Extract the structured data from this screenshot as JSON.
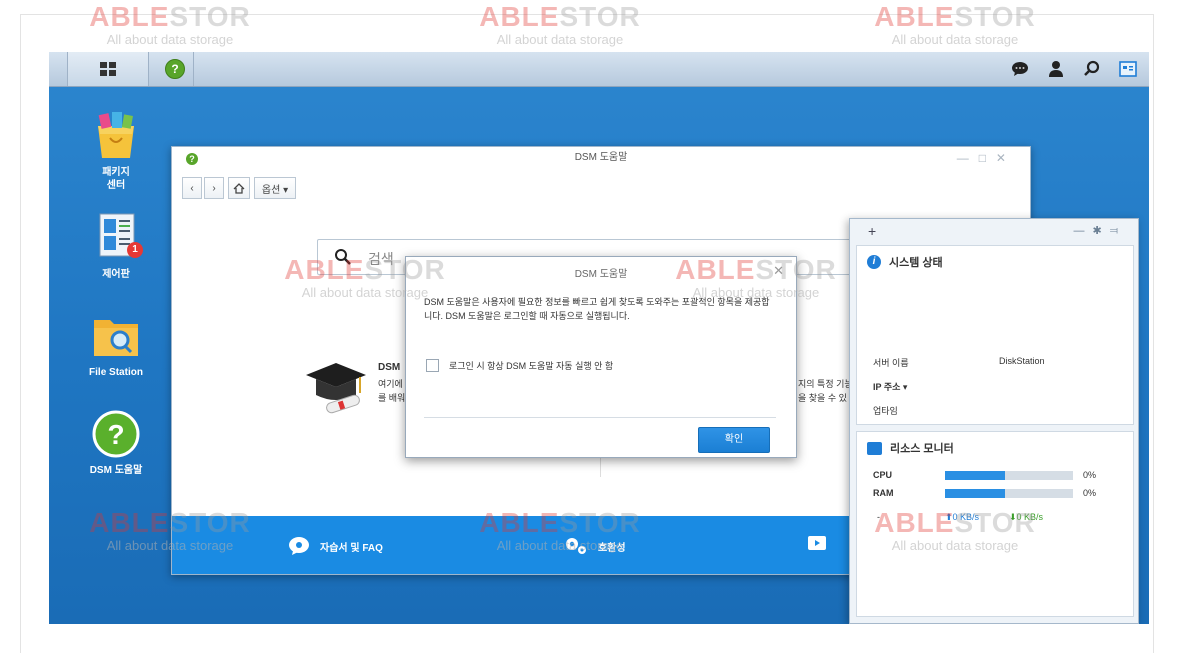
{
  "watermark": {
    "brand_part1": "ABLE",
    "brand_part2": "STOR",
    "tagline": "All about data storage"
  },
  "taskbar": {
    "right_icons": [
      "chat-icon",
      "user-icon",
      "search-icon",
      "widget-icon"
    ]
  },
  "desktop_icons": [
    {
      "label_line1": "패키지",
      "label_line2": "센터",
      "icon": "package-center-icon"
    },
    {
      "label_line1": "제어판",
      "label_line2": "",
      "icon": "control-panel-icon",
      "badge": "1"
    },
    {
      "label_line1": "File Station",
      "label_line2": "",
      "icon": "folder-icon"
    },
    {
      "label_line1": "DSM 도움말",
      "label_line2": "",
      "icon": "help-icon"
    }
  ],
  "help_window": {
    "title": "DSM 도움말",
    "options_label": "옵션 ▾",
    "search_placeholder": "검색",
    "content_title": "DSM",
    "content_left_line1": "여기에",
    "content_left_line2": "를 배워",
    "content_right_line1": "지의 특정 기능",
    "content_right_line2": "을 찾을 수 있",
    "footer": {
      "faq_label": "자습서 및 FAQ",
      "compat_label": "호환성"
    }
  },
  "dialog": {
    "title": "DSM 도움말",
    "message": "DSM 도움말은 사용자에 필요한 정보를 빠르고 쉽게 찾도록 도와주는 포괄적인 항목을 제공합니다. DSM 도움말은 로그인할 때 자동으로 실행됩니다.",
    "checkbox_label": "로그인 시 항상 DSM 도움말 자동 실행 안 함",
    "ok_label": "확인"
  },
  "widget": {
    "system_status": {
      "title": "시스템 상태",
      "server_name_label": "서버 이름",
      "server_name_value": "DiskStation",
      "ip_label": "IP 주소 ▾",
      "uptime_label": "업타임"
    },
    "resource_monitor": {
      "title": "리소스 모니터",
      "cpu_label": "CPU",
      "cpu_value": "0%",
      "cpu_fill": 0.47,
      "ram_label": "RAM",
      "ram_value": "0%",
      "ram_fill": 0.47,
      "net_dash": "-",
      "upload": "0 KB/s",
      "download": "0 KB/s"
    }
  }
}
